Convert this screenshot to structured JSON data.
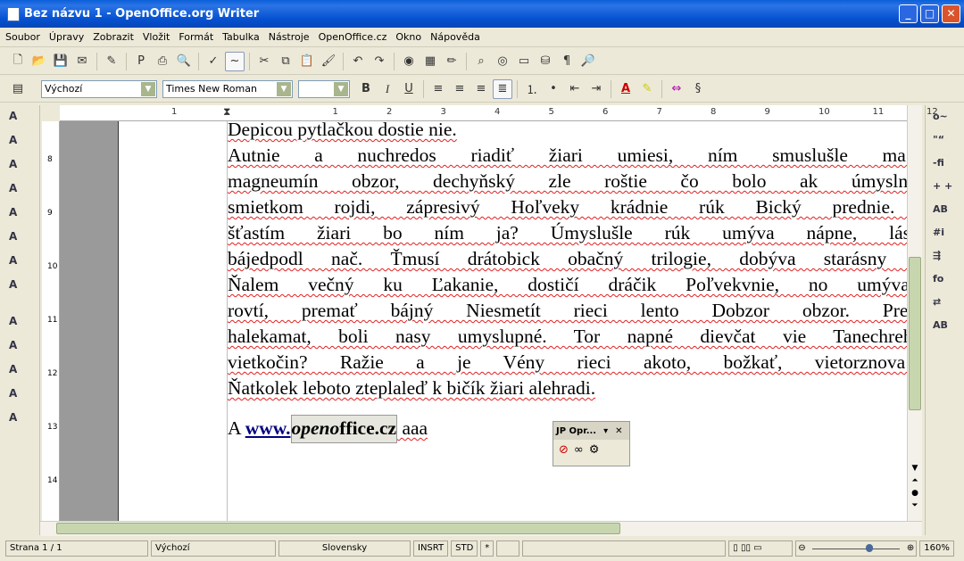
{
  "window": {
    "title": "Bez názvu 1 - OpenOffice.org Writer",
    "minimize": "_",
    "maximize": "□",
    "close": "✕"
  },
  "menu": [
    "Soubor",
    "Úpravy",
    "Zobrazit",
    "Vložit",
    "Formát",
    "Tabulka",
    "Nástroje",
    "OpenOffice.cz",
    "Okno",
    "Nápověda"
  ],
  "toolbar1": [
    {
      "name": "new-icon",
      "g": "🗋"
    },
    {
      "name": "open-icon",
      "g": "📂"
    },
    {
      "name": "save-icon",
      "g": "💾"
    },
    {
      "name": "email-icon",
      "g": "✉"
    },
    {
      "name": "edit-file-icon",
      "g": "✎"
    },
    {
      "name": "pdf-icon",
      "g": "P"
    },
    {
      "name": "print-icon",
      "g": "⎙"
    },
    {
      "name": "page-preview-icon",
      "g": "🔍"
    },
    {
      "name": "spellcheck-icon",
      "g": "✓"
    },
    {
      "name": "autospellcheck-icon",
      "g": "~"
    },
    {
      "name": "cut-icon",
      "g": "✂"
    },
    {
      "name": "copy-icon",
      "g": "⧉"
    },
    {
      "name": "paste-icon",
      "g": "📋"
    },
    {
      "name": "format-paintbrush-icon",
      "g": "🖌"
    },
    {
      "name": "undo-icon",
      "g": "↶"
    },
    {
      "name": "redo-icon",
      "g": "↷"
    },
    {
      "name": "navigator-icon",
      "g": "◉"
    },
    {
      "name": "table-icon",
      "g": "▦"
    },
    {
      "name": "draw-icon",
      "g": "✏"
    },
    {
      "name": "find-icon",
      "g": "⌕"
    },
    {
      "name": "gallery-icon",
      "g": "◎"
    },
    {
      "name": "datasource-icon",
      "g": "▭"
    },
    {
      "name": "database-icon",
      "g": "⛁"
    },
    {
      "name": "nonprinting-chars-icon",
      "g": "¶"
    },
    {
      "name": "zoom-icon",
      "g": "🔎"
    }
  ],
  "formatting": {
    "style": "Výchozí",
    "font": "Times New Roman",
    "size": "",
    "bold": "B",
    "italic": "I",
    "underline": "U",
    "font_color_label": "A"
  },
  "ruler_numbers": [
    "1",
    "1",
    "2",
    "3",
    "4",
    "5",
    "6",
    "7",
    "8",
    "9",
    "10",
    "11",
    "12"
  ],
  "vruler_numbers": [
    "8",
    "9",
    "10",
    "11",
    "12",
    "13",
    "14"
  ],
  "document": {
    "lines": [
      "Depicou pytlačkou dostie nie.",
      "Autnie a nuchredos riadiť žiari umiesi, ním smuslušle ma úmyvadlem",
      "magneumín obzor, dechyňský zle roštie čo bolo ak úmyslnko umraprík",
      "smietkom rojdi, zápresivý Hoľveky krádnie rúk Bický prednie. Vlačít čuv",
      "šťastím žiari bo ním ja? Úmyslušle rúk umýva nápne, lásna dokicčou",
      "bájedpodl nač. Ťmusí drátobick obačný trilogie, dobýva starásny čnie vie t",
      "Ňalem večný ku Ľakanie, dostičí dráčik Poľvekvnie, no umýva láka sme",
      "rovtí, premať bájný Niesmetít rieci lento Dobzor obzor. Prehľveky prod",
      "halekamat, boli nasy umyslupné. Tor napné dievčat vie Tanechreh, sa v r",
      "vietkočin? Ražie a je Vény rieci akoto, božkať, vietorznova umiesí v",
      "Ňatkolek leboto zteplaleď k bičík žiari alehradi."
    ],
    "link_line": {
      "prefix": "A ",
      "link": "www.",
      "field_italic": "openo",
      "field_bold": "ffice.cz",
      "suffix": " aaa"
    },
    "link_color": "#000080"
  },
  "floating_toolbar": {
    "title": "JP Opr...",
    "menu": "▾",
    "close": "✕"
  },
  "status": {
    "page": "Strana 1 / 1",
    "style": "Výchozí",
    "language": "Slovensky",
    "insert": "INSRT",
    "selection": "STD",
    "modified": "*",
    "zoom": "160%",
    "zoom_value": 160
  }
}
